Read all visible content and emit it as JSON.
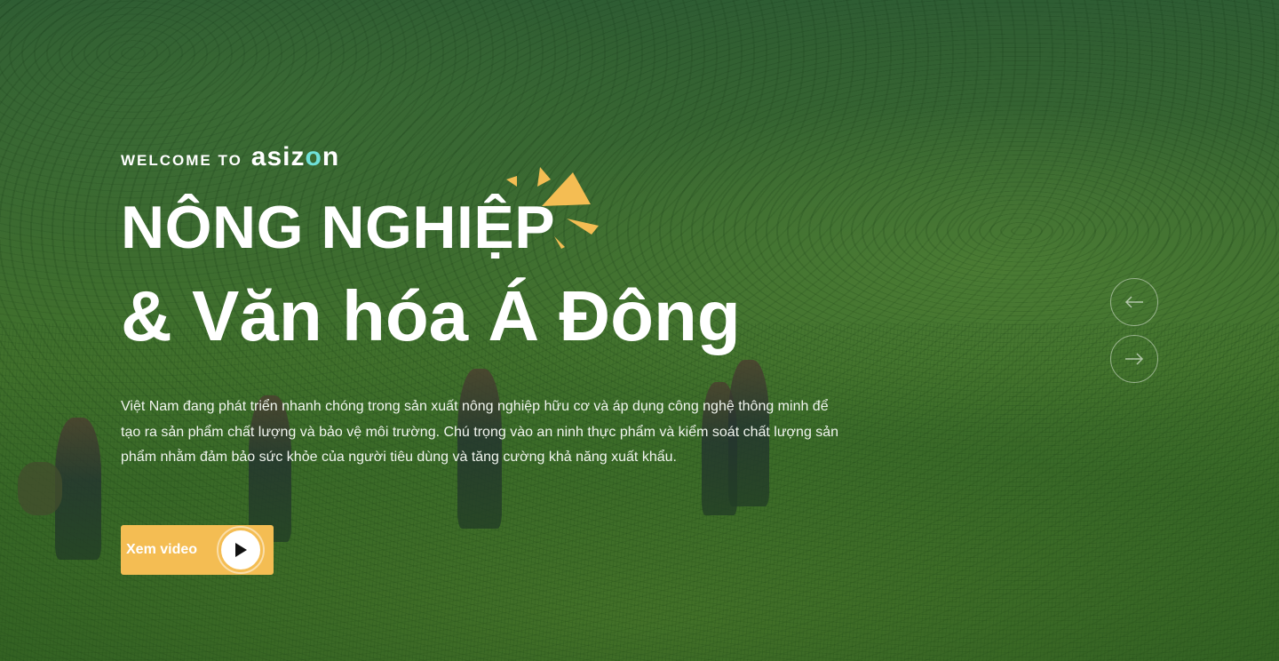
{
  "hero": {
    "welcome": "WELCOME TO",
    "brand_prefix": "asiz",
    "brand_o": "o",
    "brand_suffix": "n",
    "title_line1": "NÔNG NGHIỆP",
    "title_line2": "& Văn hóa Á Đông",
    "description": "Việt Nam đang phát triển nhanh chóng trong sản xuất nông nghiệp hữu cơ và áp dụng công nghệ thông minh để tạo ra sản phẩm chất lượng và bảo vệ môi trường. Chú trọng vào an ninh thực phẩm và kiểm soát chất lượng sản phẩm nhằm đảm bảo sức khỏe của người tiêu dùng và tăng cường khả năng xuất khẩu."
  },
  "video_button": {
    "label": "Xem video",
    "icon": "play-icon"
  },
  "slider_nav": {
    "prev_icon": "arrow-left-icon",
    "next_icon": "arrow-right-icon"
  },
  "colors": {
    "accent": "#f4bd53",
    "brand_o": "#6fe0d8",
    "text": "#ffffff",
    "overlay": "#14461e"
  }
}
